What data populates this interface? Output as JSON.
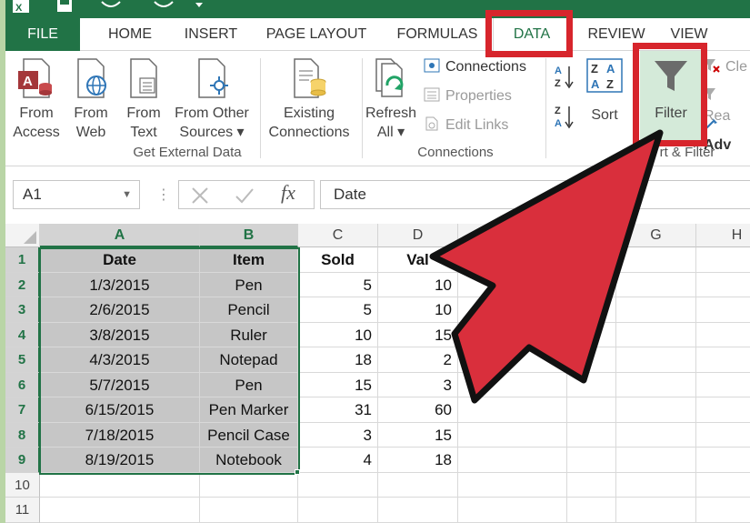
{
  "ribbon_tabs": [
    {
      "label": "FILE"
    },
    {
      "label": "HOME"
    },
    {
      "label": "INSERT"
    },
    {
      "label": "PAGE LAYOUT"
    },
    {
      "label": "FORMULAS"
    },
    {
      "label": "DATA"
    },
    {
      "label": "REVIEW"
    },
    {
      "label": "VIEW"
    }
  ],
  "get_external_data": {
    "buttons": [
      {
        "label1": "From",
        "label2": "Access"
      },
      {
        "label1": "From",
        "label2": "Web"
      },
      {
        "label1": "From",
        "label2": "Text"
      },
      {
        "label1": "From Other",
        "label2": "Sources ▾"
      },
      {
        "label1": "Existing",
        "label2": "Connections"
      }
    ],
    "group_label": "Get External Data"
  },
  "connections": {
    "refresh_label1": "Refresh",
    "refresh_label2": "All ▾",
    "connections_label": "Connections",
    "properties_label": "Properties",
    "edit_links_label": "Edit Links",
    "group_label": "Connections"
  },
  "sort_filter": {
    "sort_label": "Sort",
    "filter_label": "Filter",
    "clear_label": "Cle",
    "reapply_label": "Rea",
    "advanced_label": "Adv",
    "group_label": "rt & Filter"
  },
  "formula_bar": {
    "name_box": "A1",
    "fx_symbol": "fx",
    "content": "Date"
  },
  "columns": [
    {
      "label": "A"
    },
    {
      "label": "B"
    },
    {
      "label": "C"
    },
    {
      "label": "D"
    },
    {
      "label": "G"
    },
    {
      "label": "H"
    }
  ],
  "rows": [
    "1",
    "2",
    "3",
    "4",
    "5",
    "6",
    "7",
    "8",
    "9",
    "10",
    "11"
  ],
  "table": {
    "headers": [
      "Date",
      "Item",
      "Sold",
      "Val"
    ],
    "data": [
      [
        "1/3/2015",
        "Pen",
        "5",
        "10"
      ],
      [
        "2/6/2015",
        "Pencil",
        "5",
        "10"
      ],
      [
        "3/8/2015",
        "Ruler",
        "10",
        "15"
      ],
      [
        "4/3/2015",
        "Notepad",
        "18",
        "2"
      ],
      [
        "5/7/2015",
        "Pen",
        "15",
        "3"
      ],
      [
        "6/15/2015",
        "Pen Marker",
        "31",
        "60"
      ],
      [
        "7/18/2015",
        "Pencil Case",
        "3",
        "15"
      ],
      [
        "8/19/2015",
        "Notebook",
        "4",
        "18"
      ]
    ]
  },
  "colors": {
    "excel_green": "#217346",
    "highlight_red": "#d7252c",
    "arrow_red": "#d92f3c",
    "selection_gray": "#c6c6c6"
  }
}
